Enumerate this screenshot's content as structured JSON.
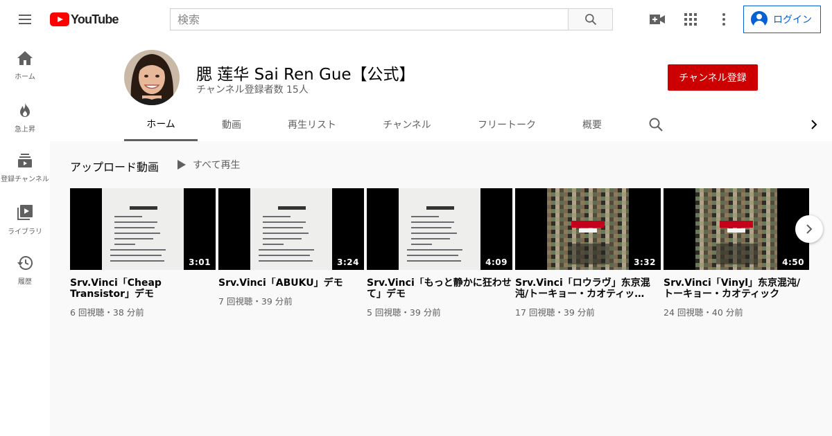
{
  "header": {
    "logo_text": "YouTube",
    "search_placeholder": "検索",
    "login_label": "ログイン",
    "accent_color": "#065fd4"
  },
  "sidebar": {
    "items": [
      {
        "label": "ホーム",
        "icon": "home-icon"
      },
      {
        "label": "急上昇",
        "icon": "flame-icon"
      },
      {
        "label": "登録チャンネル",
        "icon": "subscriptions-icon"
      },
      {
        "label": "ライブラリ",
        "icon": "library-icon"
      },
      {
        "label": "履歴",
        "icon": "history-icon"
      }
    ]
  },
  "channel": {
    "name": "腮 莲华 Sai Ren Gue【公式】",
    "subscribers": "チャンネル登録者数 15人",
    "subscribe_label": "チャンネル登録",
    "subscribe_color": "#cc0000"
  },
  "tabs": [
    {
      "label": "ホーム",
      "active": true
    },
    {
      "label": "動画",
      "active": false
    },
    {
      "label": "再生リスト",
      "active": false
    },
    {
      "label": "チャンネル",
      "active": false
    },
    {
      "label": "フリートーク",
      "active": false
    },
    {
      "label": "概要",
      "active": false
    }
  ],
  "uploads": {
    "title": "アップロード動画",
    "play_all": "すべて再生",
    "videos": [
      {
        "title": "Srv.Vinci「Cheap Transistor」デモ",
        "meta": "6 回視聴・38 分前",
        "duration": "3:01",
        "thumb": "paper"
      },
      {
        "title": "Srv.Vinci「ABUKU」デモ",
        "meta": "7 回視聴・39 分前",
        "duration": "3:24",
        "thumb": "paper"
      },
      {
        "title": "Srv.Vinci「もっと静かに狂わせて」デモ",
        "meta": "5 回視聴・39 分前",
        "duration": "4:09",
        "thumb": "paper"
      },
      {
        "title": "Srv.Vinci「ロウラヴ」东京混沌/トーキョー・カオティッ…",
        "meta": "17 回視聴・39 分前",
        "duration": "3:32",
        "thumb": "art"
      },
      {
        "title": "Srv.Vinci「Vinyl」东京混沌/トーキョー・カオティック",
        "meta": "24 回視聴・40 分前",
        "duration": "4:50",
        "thumb": "art"
      }
    ]
  }
}
